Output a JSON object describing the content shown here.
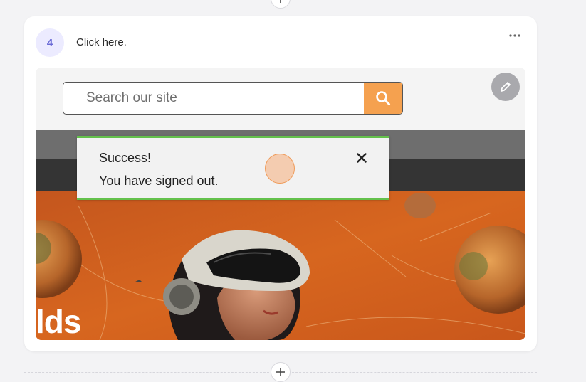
{
  "step": {
    "number": "4",
    "instruction": "Click here."
  },
  "search": {
    "placeholder": "Search our site"
  },
  "toast": {
    "title": "Success!",
    "message": "You have signed out."
  },
  "hero": {
    "text": "lds"
  },
  "add_step_label": "+",
  "colors": {
    "accent": "#f5a14f",
    "success": "#64c14c",
    "badge_bg": "#ecebff",
    "badge_text": "#6a6ad6",
    "click_marker": "#ef9a58"
  },
  "icons": [
    "more-options-icon",
    "search-icon",
    "pencil-icon",
    "close-icon",
    "plus-icon"
  ]
}
